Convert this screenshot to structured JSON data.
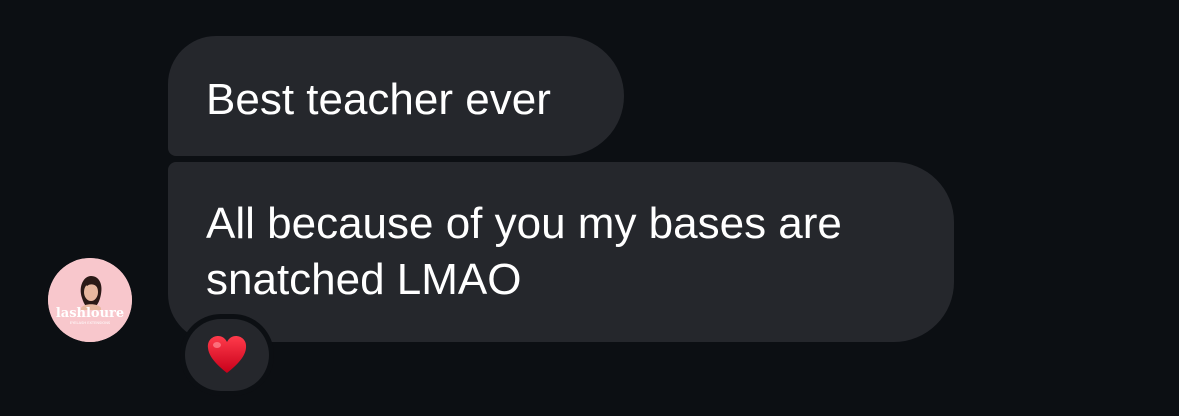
{
  "messages": [
    {
      "text": "Best teacher ever"
    },
    {
      "text": "All because of you my bases are\nsnatched LMAO"
    }
  ],
  "avatar": {
    "brand_name": "lashloure",
    "tagline": "EYELASH EXTENSIONS",
    "icon": "profile-avatar-logo"
  },
  "reaction": {
    "icon": "red-heart-icon"
  },
  "colors": {
    "background": "#0c0f13",
    "bubble": "#25272c",
    "text": "#ffffff",
    "avatar_bg": "#f8c7cc",
    "heart": "#e3001b"
  }
}
